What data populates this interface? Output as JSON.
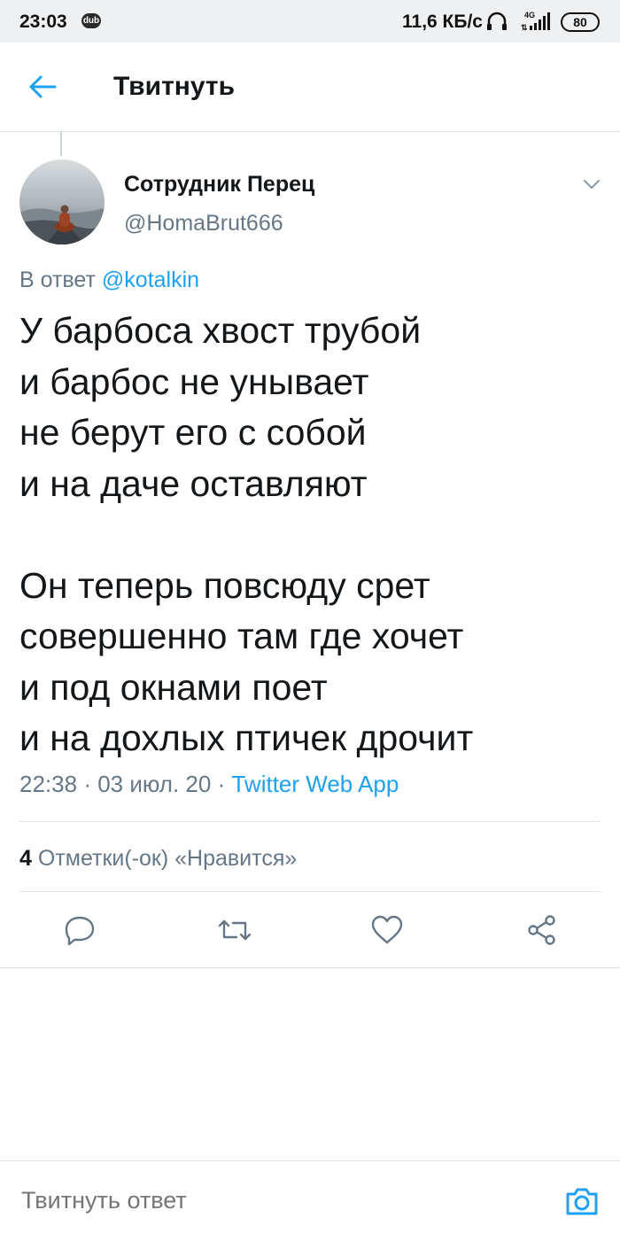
{
  "status_bar": {
    "time": "23:03",
    "badge": "dub",
    "net_speed": "11,6 КБ/с",
    "signal_label": "4G",
    "battery": "80"
  },
  "header": {
    "back_icon": "arrow-left-icon",
    "title": "Твитнуть"
  },
  "tweet": {
    "author_name": "Сотрудник Перец",
    "author_handle": "@HomaBrut666",
    "reply_prefix": "В ответ",
    "reply_mention": "@kotalkin",
    "lines": [
      "У барбоса хвост трубой",
      "и барбос не унывает",
      "не берут его с собой",
      "и на даче оставляют",
      "",
      "Он теперь повсюду срет",
      "совершенно там где хочет",
      "и под окнами поет",
      "и на дохлых птичек дрочит"
    ],
    "time": "22:38",
    "date": "03 июл. 20",
    "source": "Twitter Web App",
    "likes_count": "4",
    "likes_label": "Отметки(-ок) «Нравится»"
  },
  "actions": [
    "reply-icon",
    "retweet-icon",
    "heart-icon",
    "share-icon"
  ],
  "reply_bar": {
    "placeholder": "Твитнуть ответ",
    "camera_icon": "camera-icon"
  },
  "colors": {
    "accent": "#1da1f2",
    "muted": "#657786",
    "text": "#14171a",
    "divider": "#e1e8ed"
  }
}
